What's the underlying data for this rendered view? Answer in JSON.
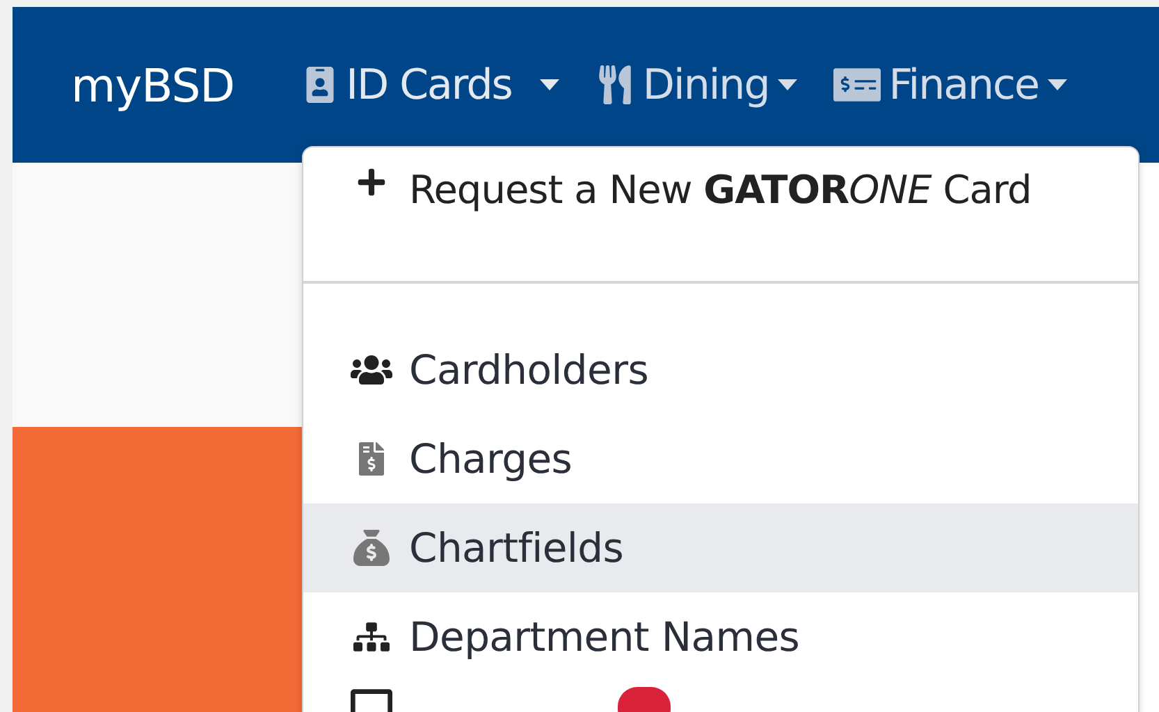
{
  "navbar": {
    "brand": "myBSD",
    "menus": [
      {
        "kind": "id",
        "label": "ID Cards",
        "expanded": true
      },
      {
        "kind": "dining",
        "label": "Dining",
        "expanded": false
      },
      {
        "kind": "finance",
        "label": "Finance",
        "expanded": false
      }
    ]
  },
  "dropdown": {
    "header_items": [
      {
        "kind": "plus",
        "parts": [
          {
            "kind": "plain",
            "text": "Request a New "
          },
          {
            "kind": "bold",
            "text": "GATOR"
          },
          {
            "kind": "italic",
            "text": "ONE"
          },
          {
            "kind": "plain",
            "text": " Card"
          }
        ]
      }
    ],
    "items": [
      {
        "kind": "users",
        "label": "Cardholders",
        "selected": false
      },
      {
        "kind": "invoice",
        "label": "Charges",
        "selected": false
      },
      {
        "kind": "sack",
        "label": "Chartfields",
        "selected": true
      },
      {
        "kind": "sitemap",
        "label": "Department Names",
        "selected": false
      }
    ],
    "cut_row": {
      "badge": true
    }
  }
}
